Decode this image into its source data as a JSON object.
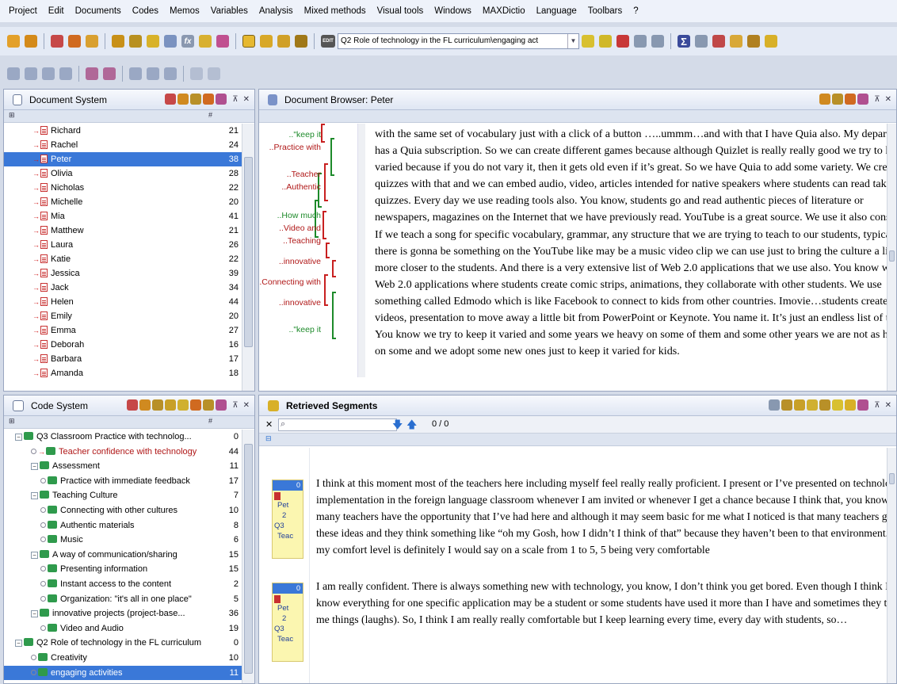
{
  "menu": [
    "Project",
    "Edit",
    "Documents",
    "Codes",
    "Memos",
    "Variables",
    "Analysis",
    "Mixed methods",
    "Visual tools",
    "Windows",
    "MAXDictio",
    "Language",
    "Toolbars",
    "?"
  ],
  "toolbar": {
    "edit_badge": "EDIT",
    "fx_label": "fx",
    "sigma_label": "Σ",
    "combo_value": "Q2 Role of technology in the FL curriculum\\engaging act"
  },
  "doc_system": {
    "title": "Document System",
    "col_hash": "#",
    "items": [
      {
        "name": "Richard",
        "count": "21"
      },
      {
        "name": "Rachel",
        "count": "24"
      },
      {
        "name": "Peter",
        "count": "38",
        "selected": true
      },
      {
        "name": "Olivia",
        "count": "28"
      },
      {
        "name": "Nicholas",
        "count": "22"
      },
      {
        "name": "Michelle",
        "count": "20"
      },
      {
        "name": "Mia",
        "count": "41"
      },
      {
        "name": "Matthew",
        "count": "21"
      },
      {
        "name": "Laura",
        "count": "26"
      },
      {
        "name": "Katie",
        "count": "22"
      },
      {
        "name": "Jessica",
        "count": "39"
      },
      {
        "name": "Jack",
        "count": "34"
      },
      {
        "name": "Helen",
        "count": "44"
      },
      {
        "name": "Emily",
        "count": "20"
      },
      {
        "name": "Emma",
        "count": "27"
      },
      {
        "name": "Deborah",
        "count": "16"
      },
      {
        "name": "Barbara",
        "count": "17"
      },
      {
        "name": "Amanda",
        "count": "18"
      }
    ]
  },
  "doc_browser": {
    "title": "Document Browser: Peter",
    "stripes": [
      {
        "label": "..\"keep it",
        "color": "green"
      },
      {
        "label": "..Practice with",
        "color": "red"
      },
      {
        "label": "..Teacher",
        "color": "red"
      },
      {
        "label": "..Authentic",
        "color": "red"
      },
      {
        "label": "..How much",
        "color": "green"
      },
      {
        "label": "..Video and",
        "color": "red"
      },
      {
        "label": "..Teaching",
        "color": "red"
      },
      {
        "label": "..innovative",
        "color": "red"
      },
      {
        "label": "..Connecting with",
        "color": "red"
      },
      {
        "label": "..innovative",
        "color": "red"
      },
      {
        "label": "..\"keep it",
        "color": "green"
      }
    ],
    "lines": [
      "with the same set of vocabulary just with a click of a button …..ummm…and with that I have Quia also. My department",
      "has a Quia subscription. So we can create different games because although Quizlet is really really good we try to keep it",
      "varied because if you do not vary it, then it gets old even if it’s great. So we have Quia to add some variety. We create",
      "quizzes with that and we can  embed audio, video, articles intended for native speakers where students can read take short",
      "quizzes. Every day we use reading tools also. You know, students go and read authentic pieces of literature or",
      "newspapers, magazines on the Internet that we have previously read. YouTube is a great source. We use it also constantly.",
      "If we teach a song for specific vocabulary, grammar, any structure that we are trying to teach to our students, typically",
      "there is gonna be something on the YouTube like may be a music video clip we can use just to bring the culture a little bit",
      "more closer to the students. And there is a very extensive list of Web 2.0 applications that we use also. You know we use",
      "Web 2.0 applications where students create comic strips, animations, they collaborate with other students. We use",
      "something called Edmodo which is like Facebook to connect to kids from other countries. Imovie…students create",
      "videos, presentation to move away a little bit from PowerPoint or Keynote. You name it. It’s just an endless list of things.",
      "You know we try to keep it varied and some years we heavy on some of them and some other years we are not  as heave",
      "on some and we adopt some new ones just to keep it varied for kids."
    ]
  },
  "code_system": {
    "title": "Code System",
    "col_hash": "#",
    "items": [
      {
        "label": "Q3 Classroom Practice with technolog...",
        "count": "0",
        "indent": 0,
        "type": "group"
      },
      {
        "label": "Teacher confidence with technology",
        "count": "44",
        "indent": 1,
        "type": "active"
      },
      {
        "label": "Assessment",
        "count": "11",
        "indent": 1,
        "type": "group"
      },
      {
        "label": "Practice with immediate feedback",
        "count": "17",
        "indent": 2,
        "type": "code"
      },
      {
        "label": "Teaching Culture",
        "count": "7",
        "indent": 1,
        "type": "group"
      },
      {
        "label": "Connecting with other cultures",
        "count": "10",
        "indent": 2,
        "type": "code"
      },
      {
        "label": "Authentic materials",
        "count": "8",
        "indent": 2,
        "type": "code"
      },
      {
        "label": "Music",
        "count": "6",
        "indent": 2,
        "type": "code"
      },
      {
        "label": "A way of communication/sharing",
        "count": "15",
        "indent": 1,
        "type": "group"
      },
      {
        "label": "Presenting information",
        "count": "15",
        "indent": 2,
        "type": "code"
      },
      {
        "label": "Instant  access to the content",
        "count": "2",
        "indent": 2,
        "type": "code"
      },
      {
        "label": "Organization: \"it's all in one place\"",
        "count": "5",
        "indent": 2,
        "type": "code"
      },
      {
        "label": "innovative projects (project-base...",
        "count": "36",
        "indent": 1,
        "type": "group"
      },
      {
        "label": "Video and Audio",
        "count": "19",
        "indent": 2,
        "type": "code"
      },
      {
        "label": "Q2 Role of technology in the FL curriculum",
        "count": "0",
        "indent": 0,
        "type": "group"
      },
      {
        "label": "Creativity",
        "count": "10",
        "indent": 1,
        "type": "code"
      },
      {
        "label": "engaging activities",
        "count": "11",
        "indent": 1,
        "type": "selected"
      }
    ]
  },
  "retrieved": {
    "title": "Retrieved Segments",
    "counter": "0 / 0",
    "segments": [
      {
        "memo": {
          "num": "0",
          "doc": "Pet",
          "pos": "2",
          "code": "Q3",
          "code_sub": "Teac"
        },
        "lines": [
          "I think at this moment  most of the teachers here including myself feel really really proficient. I present or I’ve presented on technology",
          "implementation in the foreign language classroom whenever I am invited or whenever I get a chance because I think that, you know, not",
          "many teachers have the opportunity that I’ve had here and although it may seem basic for me what I noticed is that many teachers get",
          "these ideas and they think something like “oh my Gosh, how I didn’t I think of that” because they haven’t been to that environment. So,",
          "my comfort level is definitely I would say on a scale from 1 to 5, 5 being very comfortable"
        ]
      },
      {
        "memo": {
          "num": "0",
          "doc": "Pet",
          "pos": "2",
          "code": "Q3",
          "code_sub": "Teac"
        },
        "lines": [
          "I am really confident. There is always something new with technology, you know, I don’t think you get bored. Even though I think I",
          "know everything for one specific application may be a student or some students have used it more than I have and sometimes they teach",
          "me things (laughs). So, I think I am really really comfortable but I keep learning every time, every day with students, so…"
        ]
      }
    ]
  }
}
